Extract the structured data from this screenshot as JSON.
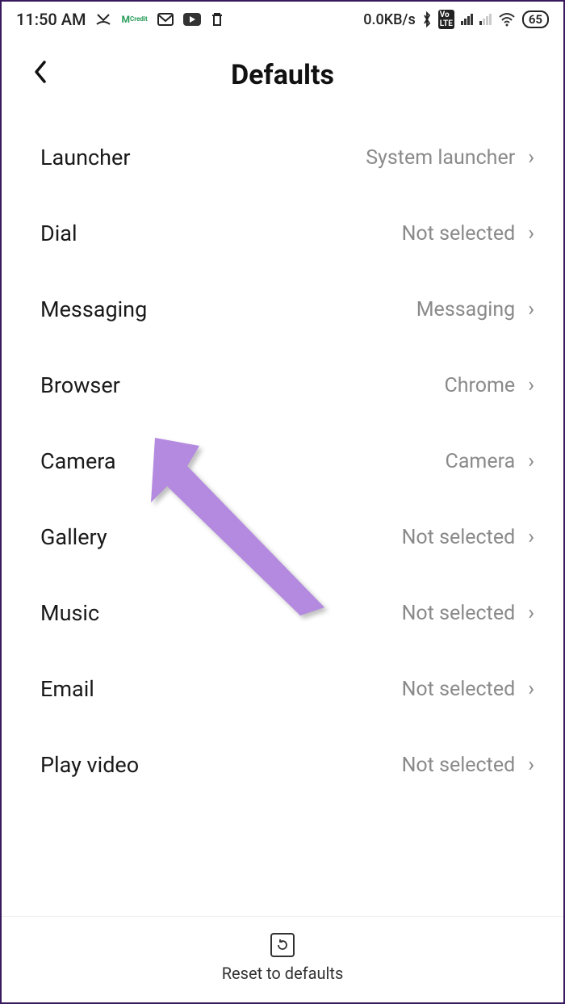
{
  "statusBar": {
    "time": "11:50 AM",
    "dataRate": "0.0KB/s",
    "battery": "65"
  },
  "header": {
    "title": "Defaults"
  },
  "items": [
    {
      "label": "Launcher",
      "value": "System launcher"
    },
    {
      "label": "Dial",
      "value": "Not selected"
    },
    {
      "label": "Messaging",
      "value": "Messaging"
    },
    {
      "label": "Browser",
      "value": "Chrome"
    },
    {
      "label": "Camera",
      "value": "Camera"
    },
    {
      "label": "Gallery",
      "value": "Not selected"
    },
    {
      "label": "Music",
      "value": "Not selected"
    },
    {
      "label": "Email",
      "value": "Not selected"
    },
    {
      "label": "Play video",
      "value": "Not selected"
    }
  ],
  "footer": {
    "label": "Reset to defaults"
  },
  "annotation": {
    "arrowColor": "#b48ae0"
  }
}
